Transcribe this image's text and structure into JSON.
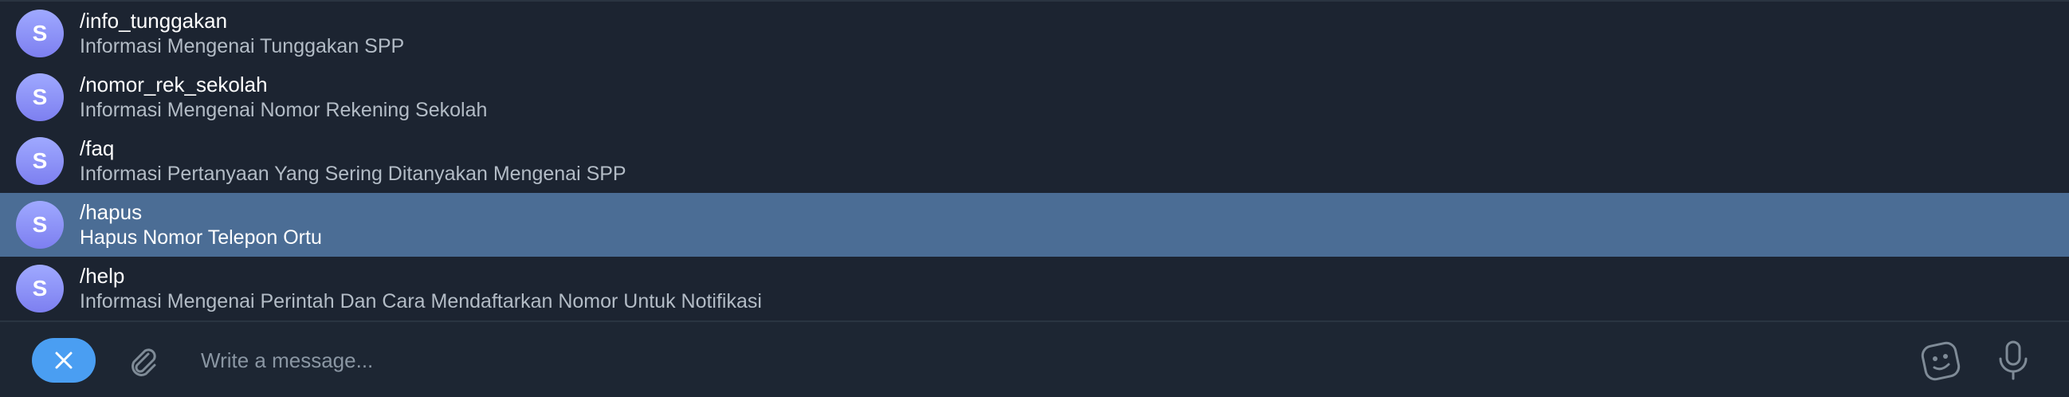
{
  "commands": [
    {
      "avatar_letter": "S",
      "name": "/info_tunggakan",
      "description": "Informasi Mengenai Tunggakan SPP"
    },
    {
      "avatar_letter": "S",
      "name": "/nomor_rek_sekolah",
      "description": "Informasi Mengenai Nomor Rekening Sekolah"
    },
    {
      "avatar_letter": "S",
      "name": "/faq",
      "description": "Informasi Pertanyaan Yang Sering Ditanyakan Mengenai SPP"
    },
    {
      "avatar_letter": "S",
      "name": "/hapus",
      "description": "Hapus Nomor Telepon Ortu",
      "selected": true
    },
    {
      "avatar_letter": "S",
      "name": "/help",
      "description": "Informasi Mengenai Perintah Dan Cara Mendaftarkan Nomor Untuk Notifikasi"
    }
  ],
  "composer": {
    "placeholder": "Write a message...",
    "value": "",
    "cancel_icon": "close-icon",
    "attach_icon": "paperclip-icon",
    "sticker_icon": "sticker-icon",
    "mic_icon": "microphone-icon"
  },
  "colors": {
    "background": "#1c2431",
    "selected_row": "#4b6d95",
    "accent": "#4a9ef2",
    "avatar_gradient_top": "#9fa9ff",
    "avatar_gradient_bottom": "#7d7ff0"
  }
}
